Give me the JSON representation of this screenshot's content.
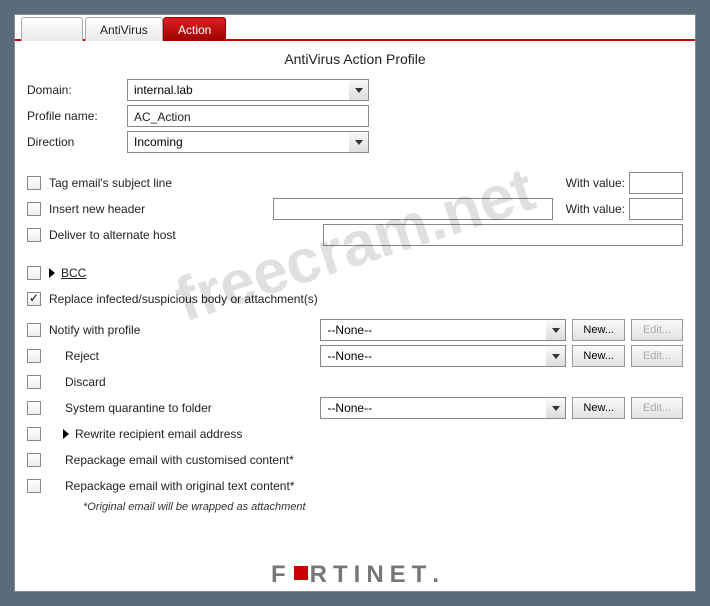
{
  "tabs": {
    "antivirus": "AntiVirus",
    "action": "Action"
  },
  "page_title": "AntiVirus Action Profile",
  "form": {
    "domain_label": "Domain:",
    "domain_value": "internal.lab",
    "profile_label": "Profile name:",
    "profile_value": "AC_Action",
    "direction_label": "Direction",
    "direction_value": "Incoming"
  },
  "options": {
    "tag_subject": "Tag email's subject line",
    "with_value": "With value:",
    "insert_header": "Insert new header",
    "deliver_host": "Deliver to alternate host",
    "bcc": "BCC",
    "replace": "Replace infected/suspicious body or attachment(s)",
    "notify": "Notify with profile",
    "reject": "Reject",
    "discard": "Discard",
    "sys_quarantine": "System quarantine to folder",
    "rewrite": "Rewrite recipient email address",
    "repack_custom": "Repackage email with customised content*",
    "repack_orig": "Repackage email with original text content*",
    "footnote": "*Original email will be wrapped as attachment"
  },
  "selects": {
    "none": "--None--",
    "reject_none": "--None--",
    "quarantine_none": "--None--"
  },
  "buttons": {
    "new": "New...",
    "edit": "Edit..."
  },
  "logo": "FORTINET",
  "watermark": "freecram.net"
}
